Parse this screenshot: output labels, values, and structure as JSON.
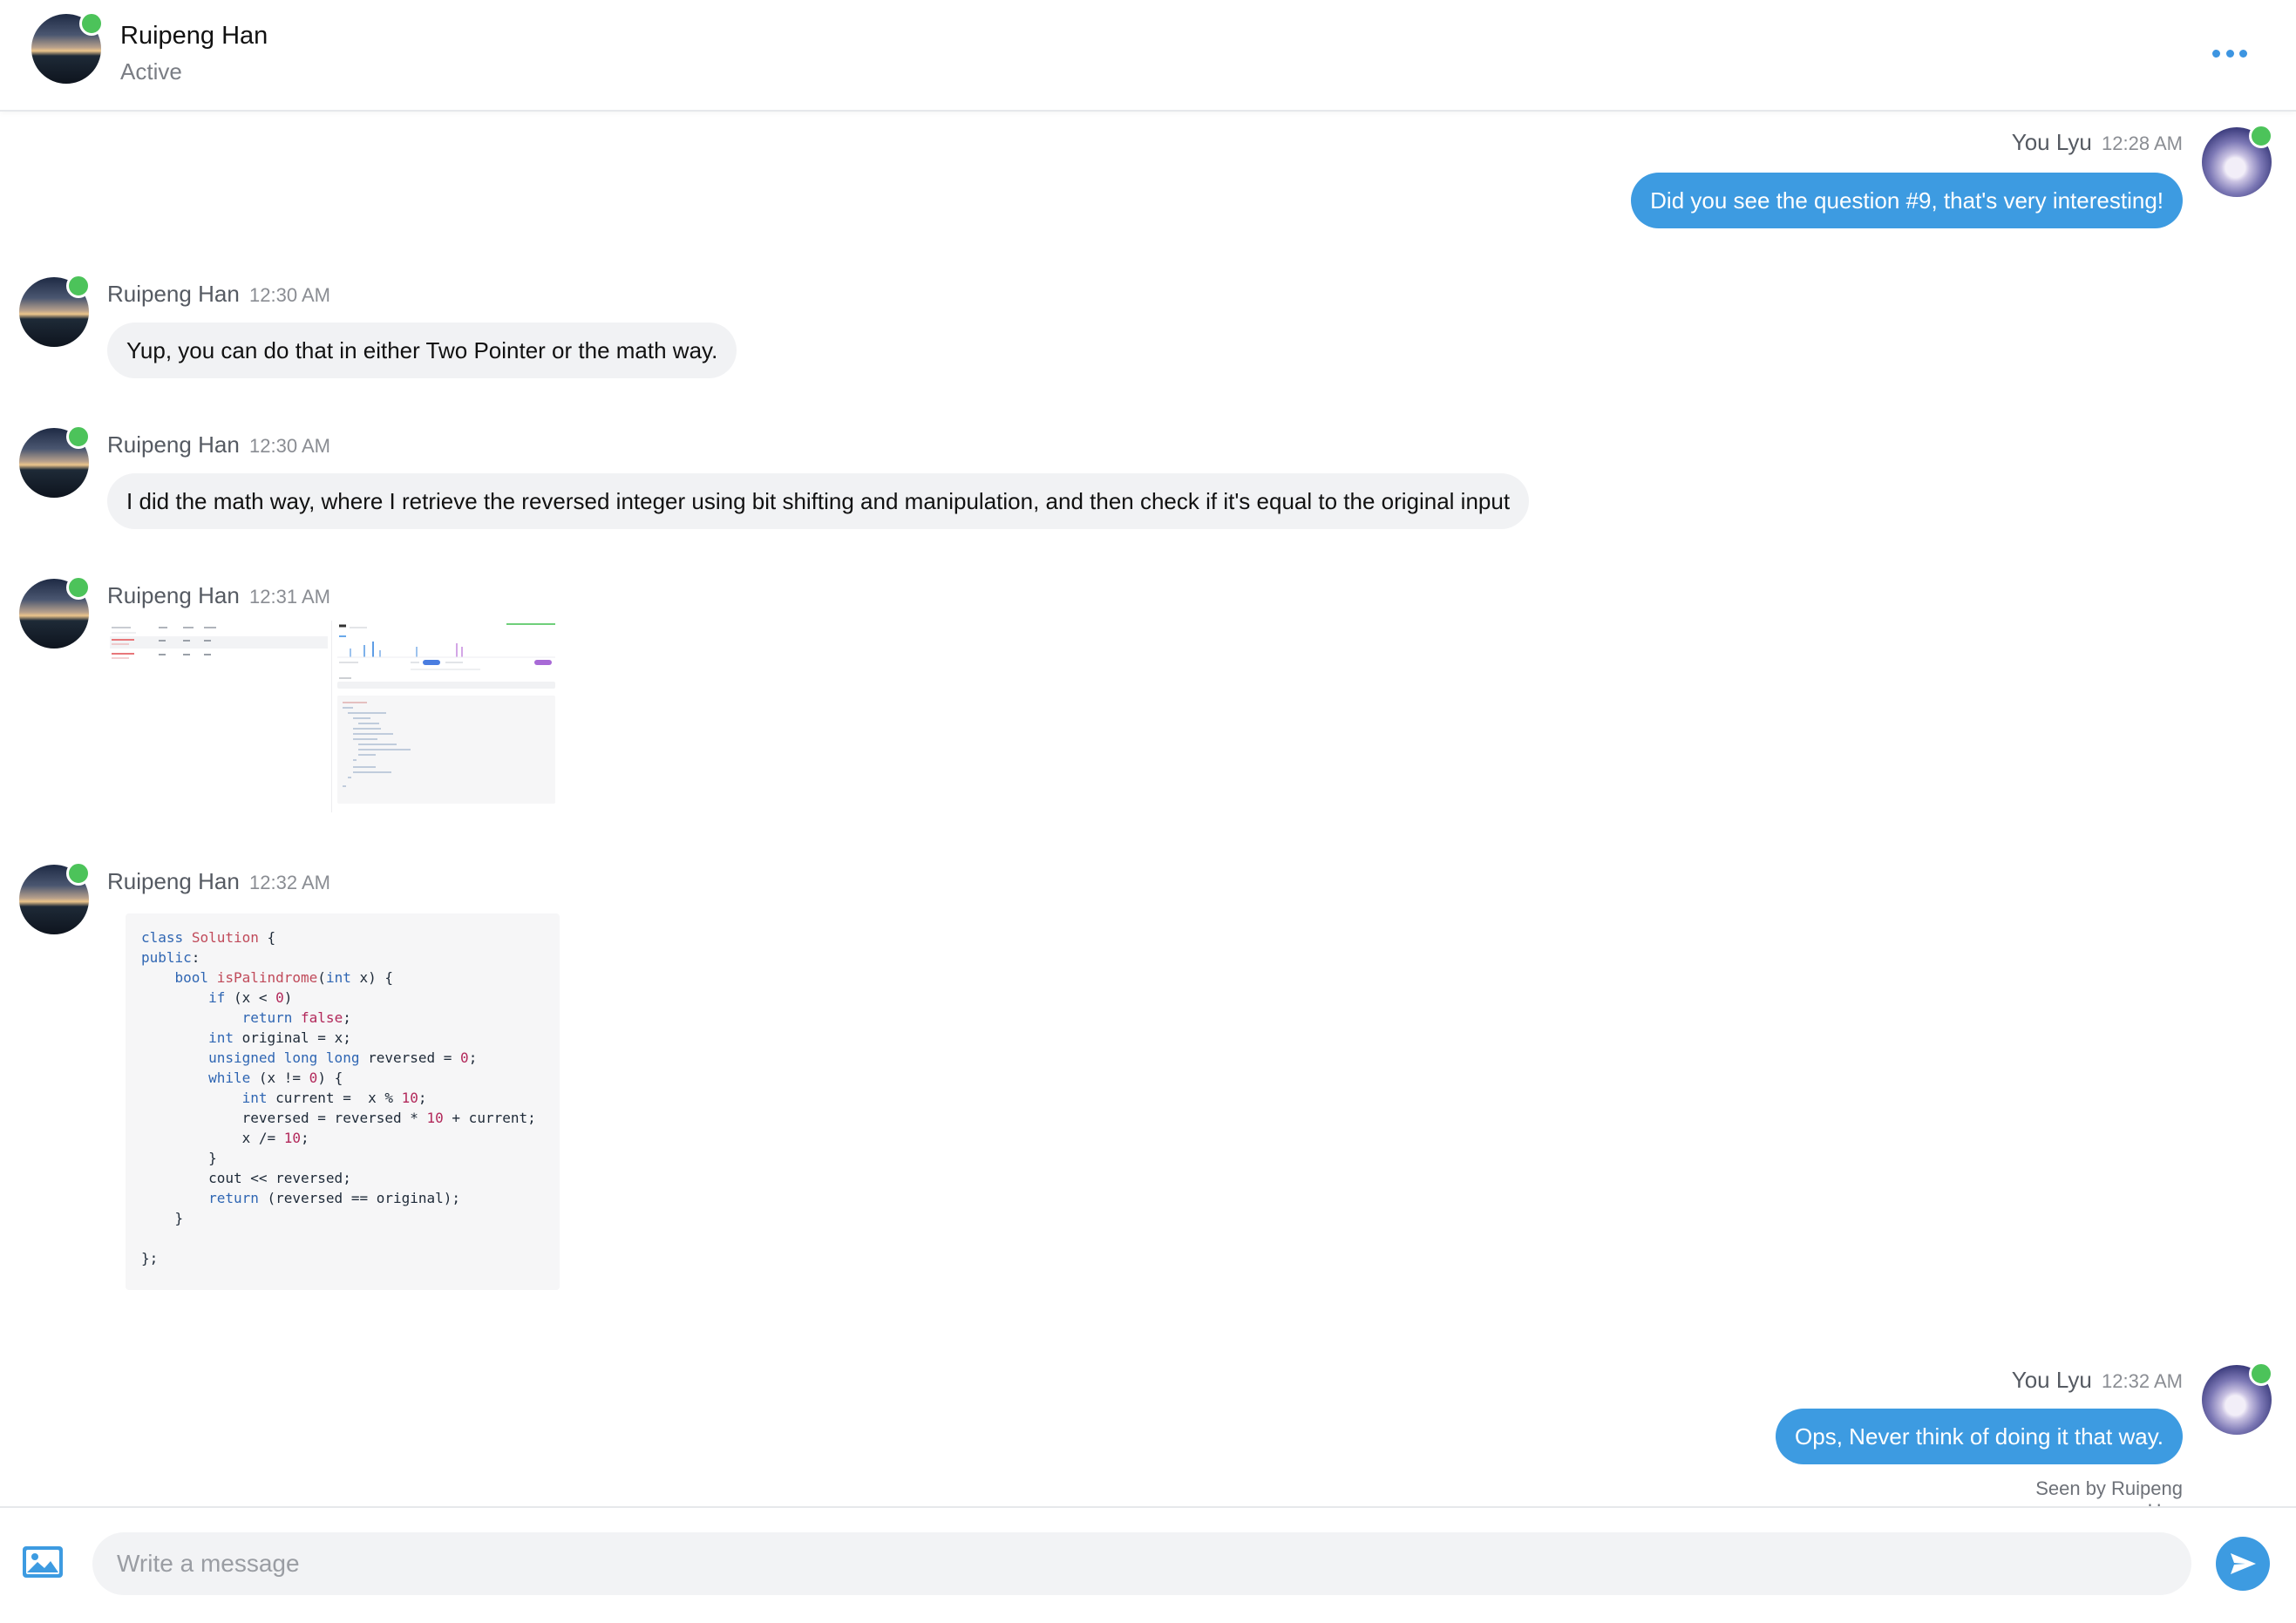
{
  "header": {
    "contact_name": "Ruipeng Han",
    "status": "Active",
    "menu_icon": "more-dots-icon"
  },
  "messages": [
    {
      "sender": "You Lyu",
      "time": "12:28 AM",
      "direction": "outgoing",
      "text": "Did you see the question #9, that's very interesting!"
    },
    {
      "sender": "Ruipeng Han",
      "time": "12:30 AM",
      "direction": "incoming",
      "text": "Yup, you can do that in either Two Pointer or the math way."
    },
    {
      "sender": "Ruipeng Han",
      "time": "12:30 AM",
      "direction": "incoming",
      "text": "I did the math way, where I retrieve the reversed integer using bit shifting and manipulation, and then check if it's equal to the original input"
    },
    {
      "sender": "Ruipeng Han",
      "time": "12:31 AM",
      "direction": "incoming",
      "type": "images"
    },
    {
      "sender": "Ruipeng Han",
      "time": "12:32 AM",
      "direction": "incoming",
      "type": "code-image"
    },
    {
      "sender": "You Lyu",
      "time": "12:32 AM",
      "direction": "outgoing",
      "text": "Ops, Never think of doing it that way."
    }
  ],
  "seen_text": "Seen by Ruipeng Han",
  "composer": {
    "placeholder": "Write a message",
    "image_icon": "image-icon",
    "send_icon": "send-icon"
  },
  "colors": {
    "accent": "#3d9be1",
    "online": "#4cc35a",
    "incoming_bubble": "#f1f2f4"
  }
}
